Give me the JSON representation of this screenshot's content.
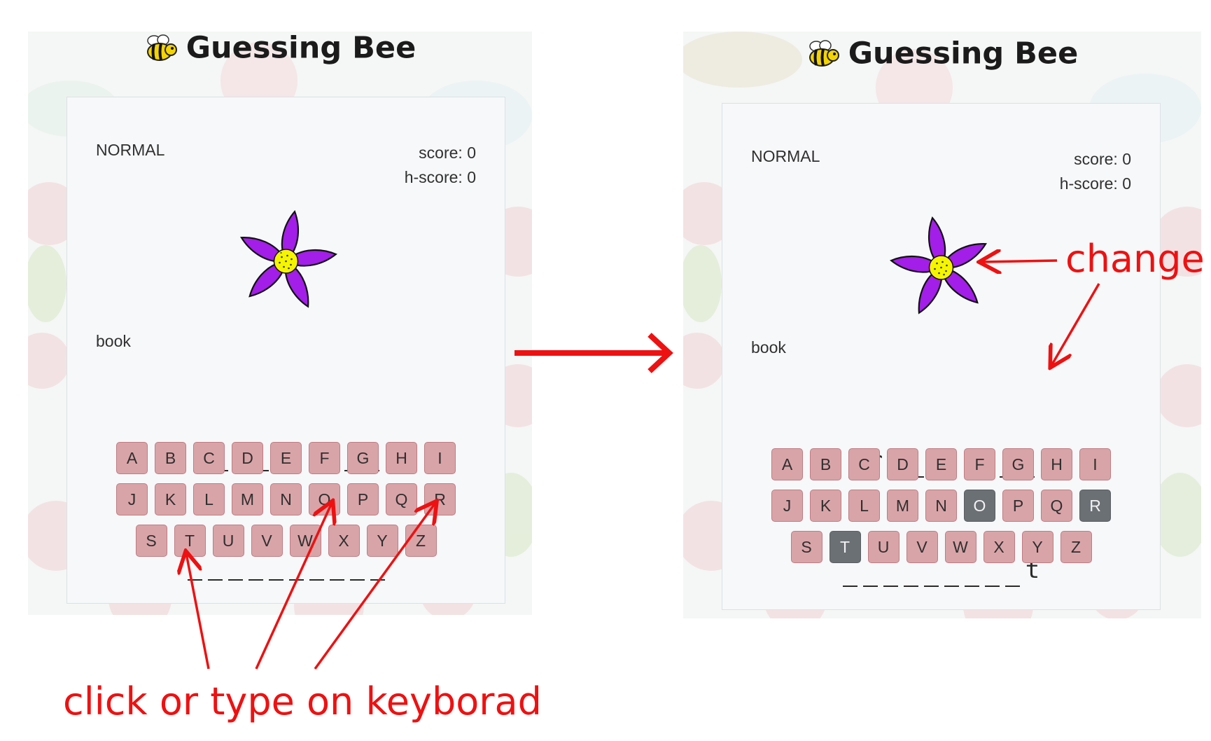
{
  "app_title": "Guessing Bee",
  "screens": [
    {
      "mode": "NORMAL",
      "score": "score: 0",
      "hscore": "h-score: 0",
      "hint": "book",
      "answer_lines": [
        [
          "_",
          "_",
          "_",
          "_",
          "_",
          " ",
          "_",
          "_",
          "_"
        ],
        [
          "_",
          "_",
          "_",
          "_",
          "_",
          "_",
          "_",
          "_",
          "_",
          "_"
        ]
      ],
      "keyboard": [
        [
          {
            "k": "A",
            "used": false
          },
          {
            "k": "B",
            "used": false
          },
          {
            "k": "C",
            "used": false
          },
          {
            "k": "D",
            "used": false
          },
          {
            "k": "E",
            "used": false
          },
          {
            "k": "F",
            "used": false
          },
          {
            "k": "G",
            "used": false
          },
          {
            "k": "H",
            "used": false
          },
          {
            "k": "I",
            "used": false
          }
        ],
        [
          {
            "k": "J",
            "used": false
          },
          {
            "k": "K",
            "used": false
          },
          {
            "k": "L",
            "used": false
          },
          {
            "k": "M",
            "used": false
          },
          {
            "k": "N",
            "used": false
          },
          {
            "k": "O",
            "used": false
          },
          {
            "k": "P",
            "used": false
          },
          {
            "k": "Q",
            "used": false
          },
          {
            "k": "R",
            "used": false
          }
        ],
        [
          {
            "k": "S",
            "used": false
          },
          {
            "k": "T",
            "used": false
          },
          {
            "k": "U",
            "used": false
          },
          {
            "k": "V",
            "used": false
          },
          {
            "k": "W",
            "used": false
          },
          {
            "k": "X",
            "used": false
          },
          {
            "k": "Y",
            "used": false
          },
          {
            "k": "Z",
            "used": false
          }
        ]
      ]
    },
    {
      "mode": "NORMAL",
      "score": "score: 0",
      "hscore": "h-score: 0",
      "hint": "book",
      "answer_lines": [
        [
          "_",
          "r",
          "_",
          "_",
          "_",
          " ",
          "_",
          "_",
          "_"
        ],
        [
          "_",
          "_",
          "_",
          "_",
          "_",
          "_",
          "_",
          "_",
          "_",
          "t"
        ]
      ],
      "keyboard": [
        [
          {
            "k": "A",
            "used": false
          },
          {
            "k": "B",
            "used": false
          },
          {
            "k": "C",
            "used": false
          },
          {
            "k": "D",
            "used": false
          },
          {
            "k": "E",
            "used": false
          },
          {
            "k": "F",
            "used": false
          },
          {
            "k": "G",
            "used": false
          },
          {
            "k": "H",
            "used": false
          },
          {
            "k": "I",
            "used": false
          }
        ],
        [
          {
            "k": "J",
            "used": false
          },
          {
            "k": "K",
            "used": false
          },
          {
            "k": "L",
            "used": false
          },
          {
            "k": "M",
            "used": false
          },
          {
            "k": "N",
            "used": false
          },
          {
            "k": "O",
            "used": true
          },
          {
            "k": "P",
            "used": false
          },
          {
            "k": "Q",
            "used": false
          },
          {
            "k": "R",
            "used": true
          }
        ],
        [
          {
            "k": "S",
            "used": false
          },
          {
            "k": "T",
            "used": true
          },
          {
            "k": "U",
            "used": false
          },
          {
            "k": "V",
            "used": false
          },
          {
            "k": "W",
            "used": false
          },
          {
            "k": "X",
            "used": false
          },
          {
            "k": "Y",
            "used": false
          },
          {
            "k": "Z",
            "used": false
          }
        ]
      ]
    }
  ],
  "annotations": {
    "caption": "click or type on keyborad",
    "change_label": "change",
    "arrow_color": "#ee1111"
  },
  "colors": {
    "key_default": "#d9a4a8",
    "key_used": "#6b7075",
    "flower_petal": "#a31ee8",
    "flower_center": "#f5f500"
  },
  "icons": {
    "title_icon": "bee-icon",
    "card_image": "flower-icon"
  }
}
